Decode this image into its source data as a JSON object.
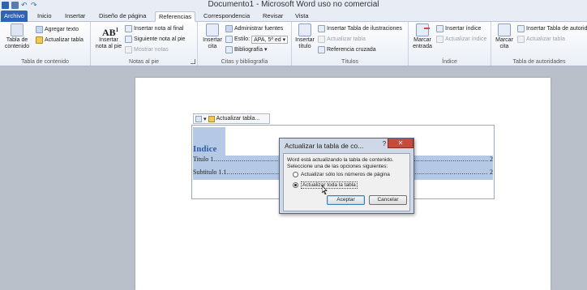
{
  "window": {
    "title": "Documento1 - Microsoft Word uso no comercial"
  },
  "quick_access": [
    {
      "name": "word-logo-icon",
      "color": "#2f63b5"
    },
    {
      "name": "save-icon",
      "color": "#5a7bb0"
    },
    {
      "name": "undo-icon",
      "color": "#4a6aa0"
    },
    {
      "name": "redo-icon",
      "color": "#4a6aa0"
    }
  ],
  "tabs": [
    "Archivo",
    "Inicio",
    "Insertar",
    "Diseño de página",
    "Referencias",
    "Correspondencia",
    "Revisar",
    "Vista"
  ],
  "active_tab": "Referencias",
  "ribbon": {
    "toc_group": {
      "label": "Tabla de contenido",
      "toc_button": "Tabla de contenido",
      "add_text": "Agregar texto",
      "update_table": "Actualizar tabla"
    },
    "footnotes_group": {
      "label": "Notas al pie",
      "insert_footnote": "Insertar nota al pie",
      "insert_endnote": "Insertar nota al final",
      "next_footnote": "Siguiente nota al pie",
      "show_notes": "Mostrar notas"
    },
    "citations_group": {
      "label": "Citas y bibliografía",
      "insert_citation": "Insertar cita",
      "manage_sources": "Administrar fuentes",
      "style_label": "Estilo:",
      "style_value": "APA, 5ª ed",
      "bibliography": "Bibliografía"
    },
    "captions_group": {
      "label": "Títulos",
      "insert_caption": "Insertar título",
      "insert_table_figures": "Insertar Tabla de ilustraciones",
      "update_table": "Actualizar tabla",
      "cross_reference": "Referencia cruzada"
    },
    "index_group": {
      "label": "Índice",
      "mark_entry": "Marcar entrada",
      "insert_index": "Insertar índice",
      "update_index": "Actualizar índice"
    },
    "authorities_group": {
      "label": "Tabla de autoridades",
      "mark_citation": "Marcar cita",
      "insert_authorities": "Insertar Tabla de autoridades",
      "update_table": "Actualizar tabla"
    }
  },
  "document": {
    "toc_toolbar_label": "Actualizar tabla...",
    "toc_heading": "Indice",
    "entries": [
      {
        "label": "Titulo 1",
        "page": "2"
      },
      {
        "label": "Subtitulo 1.1",
        "page": "2"
      }
    ]
  },
  "dialog": {
    "title": "Actualizar la tabla de co...",
    "help": "?",
    "close": "✕",
    "message_line1": "Word está actualizando la tabla de contenido.",
    "message_line2": "Seleccione una de las opciones siguientes:",
    "option_pages": "Actualizar sólo los números de página",
    "option_all": "Actualizar toda la tabla",
    "selected_option": "option_all",
    "ok_button": "Aceptar",
    "cancel_button": "Cancelar"
  },
  "dots": "......................................................................................................................................................................................"
}
